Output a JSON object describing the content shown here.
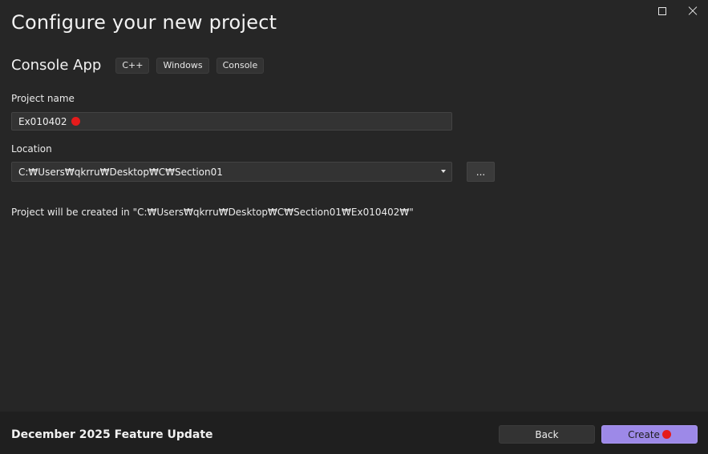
{
  "window": {
    "controls": {
      "maximize_icon": "maximize-icon",
      "close_icon": "close-icon"
    }
  },
  "header": {
    "title": "Configure your new project"
  },
  "template": {
    "name": "Console App",
    "tags": [
      "C++",
      "Windows",
      "Console"
    ]
  },
  "project_name": {
    "label": "Project name",
    "value": "Ex010402"
  },
  "location": {
    "label": "Location",
    "value": "C:₩Users₩qkrru₩Desktop₩C₩Section01",
    "browse_label": "..."
  },
  "path_preview": "Project will be created in \"C:₩Users₩qkrru₩Desktop₩C₩Section01₩Ex010402₩\"",
  "footer": {
    "version_text": "December 2025 Feature Update",
    "back_label": "Back",
    "create_label": "Create"
  },
  "colors": {
    "background": "#262626",
    "footer": "#1f1f1f",
    "accent": "#9d89e8",
    "marker": "#e51b1b"
  }
}
